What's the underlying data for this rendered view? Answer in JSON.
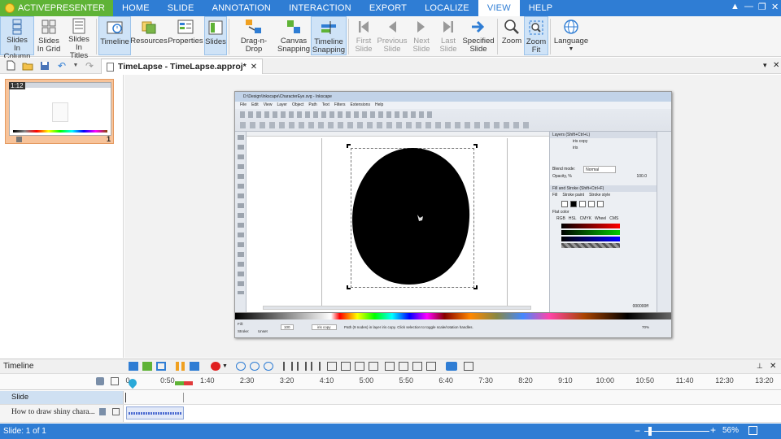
{
  "menubar": {
    "app_label": "ACTIVEPRESENTER",
    "items": [
      "HOME",
      "SLIDE",
      "ANNOTATION",
      "INTERACTION",
      "EXPORT",
      "LOCALIZE",
      "VIEW",
      "HELP"
    ],
    "active": "VIEW"
  },
  "ribbon": {
    "slides_in_column": "Slides In Column",
    "slides_in_grid": "Slides In Grid",
    "slides_in_titles": "Slides In Titles",
    "timeline": "Timeline",
    "resources": "Resources",
    "properties": "Properties",
    "slides": "Slides",
    "drag_n_drop": "Drag-n-Drop",
    "canvas_snapping": "Canvas Snapping",
    "timeline_snapping": "Timeline Snapping",
    "first_slide": "First Slide",
    "previous_slide": "Previous Slide",
    "next_slide": "Next Slide",
    "last_slide": "Last Slide",
    "specified_slide": "Specified Slide",
    "zoom": "Zoom",
    "zoom_fit": "Zoom Fit",
    "language": "Language"
  },
  "document_tab": {
    "title": "TimeLapse - TimeLapse.approj*"
  },
  "slide_thumb": {
    "duration": "1:12",
    "number": "1"
  },
  "inkscape": {
    "title": "D:\\Design\\Inkscape\\CharacterEye.svg - Inkscape",
    "menus": [
      "File",
      "Edit",
      "View",
      "Layer",
      "Object",
      "Path",
      "Text",
      "Filters",
      "Extensions",
      "Help"
    ],
    "layers_title": "Layers (Shift+Ctrl+L)",
    "layer_1": "iris copy",
    "layer_2": "iris",
    "blend_label": "Blend mode:",
    "blend_value": "Normal",
    "opacity_label": "Opacity, %",
    "opacity_value": "100.0",
    "fill_title": "Fill and Stroke (Shift+Ctrl+F)",
    "fill_tab": "Fill",
    "stroke_paint_tab": "Stroke paint",
    "stroke_style_tab": "Stroke style",
    "flat_color": "Flat color",
    "color_modes": [
      "RGB",
      "HSL",
      "CMYK",
      "Wheel",
      "CMS"
    ],
    "rgba_value": "000000ff",
    "status_text": "Path (9 nodes) in layer iris copy. Click selection to toggle scale/rotation handles.",
    "zoom_value": "70%",
    "stroke_label": "Stroke:",
    "fill_label": "Fill:",
    "stroke_value": "Unset",
    "opacity_box": "100",
    "layer_select": "iris copy"
  },
  "timeline": {
    "title": "Timeline",
    "ticks": [
      "0",
      "0:50",
      "1:40",
      "2:30",
      "3:20",
      "4:10",
      "5:00",
      "5:50",
      "6:40",
      "7:30",
      "8:20",
      "9:10",
      "10:00",
      "10:50",
      "11:40",
      "12:30",
      "13:20"
    ],
    "slide_track": "Slide",
    "media_track": "How to draw shiny chara..."
  },
  "statusbar": {
    "slide_info": "Slide: 1 of 1",
    "zoom": "56%"
  }
}
